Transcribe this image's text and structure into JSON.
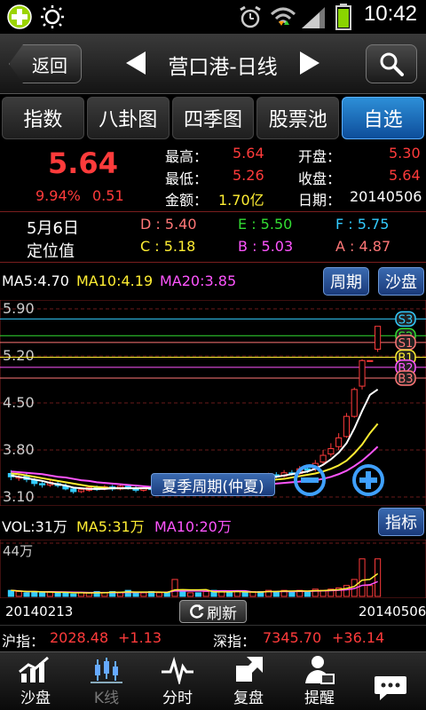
{
  "status": {
    "time": "10:42"
  },
  "header": {
    "back_label": "返回",
    "title": "营口港-日线"
  },
  "tabs": [
    {
      "label": "指数",
      "active": false
    },
    {
      "label": "八卦图",
      "active": false
    },
    {
      "label": "四季图",
      "active": false
    },
    {
      "label": "股票池",
      "active": false
    },
    {
      "label": "自选",
      "active": true
    }
  ],
  "quote": {
    "price": "5.64",
    "change_pct": "9.94%",
    "change": "0.51",
    "high_label": "最高：",
    "high": "5.64",
    "low_label": "最低：",
    "low": "5.26",
    "amount_label": "金额：",
    "amount": "1.70亿",
    "open_label": "开盘：",
    "open": "5.30",
    "close_label": "收盘：",
    "close": "5.64",
    "date_label": "日期：",
    "date": "20140506"
  },
  "position": {
    "date": "5月6日",
    "label": "定位值",
    "D": "D : 5.40",
    "E": "E : 5.50",
    "F": "F : 5.75",
    "C": "C : 5.18",
    "B": "B : 5.03",
    "A": "A : 4.87"
  },
  "ma": {
    "ma5": "MA5:4.70",
    "ma10": "MA10:4.19",
    "ma20": "MA20:3.85",
    "period_btn": "周期",
    "sandbox_btn": "沙盘"
  },
  "kchart": {
    "y_ticks": [
      "5.90",
      "5.20",
      "4.50",
      "3.80",
      "3.10"
    ],
    "levels": [
      "S3",
      "S2",
      "S1",
      "B1",
      "B2",
      "B3"
    ],
    "season_label": "夏季周期(仲夏)"
  },
  "vol": {
    "vol": "VOL:31万",
    "ma5": "MA5:31万",
    "ma10": "MA10:20万",
    "indicator_btn": "指标",
    "ymax": "44万"
  },
  "dates": {
    "start": "20140213",
    "end": "20140506",
    "refresh": "刷新"
  },
  "index": {
    "sh_label": "沪指：",
    "sh_value": "2028.48",
    "sh_change": "+1.13",
    "sz_label": "深指：",
    "sz_value": "7345.70",
    "sz_change": "+36.14"
  },
  "nav": [
    {
      "label": "沙盘",
      "icon": "chart-up-icon",
      "enabled": true
    },
    {
      "label": "K线",
      "icon": "candlestick-icon",
      "enabled": false
    },
    {
      "label": "分时",
      "icon": "pulse-icon",
      "enabled": true
    },
    {
      "label": "复盘",
      "icon": "arrows-icon",
      "enabled": true
    },
    {
      "label": "提醒",
      "icon": "person-icon",
      "enabled": true
    },
    {
      "label": "",
      "icon": "chat-icon",
      "enabled": true
    }
  ],
  "chart_data": {
    "type": "candlestick",
    "ylim": [
      3.1,
      5.9
    ],
    "candles": [
      [
        3.45,
        3.4,
        3.5,
        3.35
      ],
      [
        3.38,
        3.4,
        3.44,
        3.34
      ],
      [
        3.42,
        3.36,
        3.45,
        3.32
      ],
      [
        3.35,
        3.3,
        3.38,
        3.26
      ],
      [
        3.3,
        3.28,
        3.34,
        3.24
      ],
      [
        3.28,
        3.32,
        3.36,
        3.25
      ],
      [
        3.3,
        3.27,
        3.33,
        3.24
      ],
      [
        3.26,
        3.22,
        3.3,
        3.2
      ],
      [
        3.22,
        3.18,
        3.25,
        3.15
      ],
      [
        3.18,
        3.21,
        3.24,
        3.16
      ],
      [
        3.2,
        3.24,
        3.27,
        3.18
      ],
      [
        3.24,
        3.21,
        3.27,
        3.19
      ],
      [
        3.22,
        3.25,
        3.28,
        3.2
      ],
      [
        3.25,
        3.22,
        3.28,
        3.19
      ],
      [
        3.22,
        3.26,
        3.29,
        3.2
      ],
      [
        3.26,
        3.23,
        3.29,
        3.21
      ],
      [
        3.23,
        3.2,
        3.26,
        3.17
      ],
      [
        3.2,
        3.23,
        3.26,
        3.18
      ],
      [
        3.23,
        3.21,
        3.25,
        3.19
      ],
      [
        3.22,
        3.26,
        3.28,
        3.2
      ],
      [
        3.26,
        3.24,
        3.29,
        3.22
      ],
      [
        3.24,
        3.28,
        3.31,
        3.22
      ],
      [
        3.28,
        3.25,
        3.31,
        3.23
      ],
      [
        3.26,
        3.3,
        3.33,
        3.24
      ],
      [
        3.3,
        3.27,
        3.33,
        3.25
      ],
      [
        3.28,
        3.32,
        3.35,
        3.26
      ],
      [
        3.32,
        3.3,
        3.36,
        3.28
      ],
      [
        3.3,
        3.34,
        3.37,
        3.28
      ],
      [
        3.34,
        3.32,
        3.38,
        3.3
      ],
      [
        3.33,
        3.36,
        3.4,
        3.31
      ],
      [
        3.36,
        3.34,
        3.4,
        3.32
      ],
      [
        3.35,
        3.4,
        3.43,
        3.33
      ],
      [
        3.4,
        3.38,
        3.44,
        3.36
      ],
      [
        3.38,
        3.43,
        3.46,
        3.36
      ],
      [
        3.43,
        3.4,
        3.47,
        3.38
      ],
      [
        3.41,
        3.46,
        3.5,
        3.39
      ],
      [
        3.46,
        3.44,
        3.5,
        3.42
      ],
      [
        3.45,
        3.52,
        3.56,
        3.43
      ],
      [
        3.52,
        3.5,
        3.58,
        3.46
      ],
      [
        3.51,
        3.6,
        3.65,
        3.48
      ],
      [
        3.62,
        3.72,
        3.8,
        3.58
      ],
      [
        3.74,
        3.82,
        3.9,
        3.7
      ],
      [
        3.85,
        3.98,
        4.05,
        3.8
      ],
      [
        4.0,
        4.3,
        4.35,
        3.98
      ],
      [
        4.3,
        4.7,
        4.73,
        4.28
      ],
      [
        4.75,
        5.13,
        5.15,
        4.7
      ],
      [
        5.13,
        5.13,
        5.13,
        5.13
      ],
      [
        5.3,
        5.64,
        5.64,
        5.26
      ]
    ],
    "ma5": [
      3.42,
      3.4,
      3.38,
      3.36,
      3.34,
      3.31,
      3.29,
      3.27,
      3.24,
      3.23,
      3.22,
      3.22,
      3.22,
      3.23,
      3.23,
      3.23,
      3.23,
      3.23,
      3.23,
      3.23,
      3.23,
      3.24,
      3.25,
      3.26,
      3.27,
      3.28,
      3.29,
      3.3,
      3.31,
      3.33,
      3.34,
      3.35,
      3.36,
      3.38,
      3.4,
      3.42,
      3.44,
      3.46,
      3.48,
      3.52,
      3.58,
      3.66,
      3.76,
      3.9,
      4.12,
      4.38,
      4.62,
      4.7
    ],
    "ma10": [
      3.45,
      3.44,
      3.42,
      3.4,
      3.38,
      3.36,
      3.34,
      3.32,
      3.3,
      3.28,
      3.26,
      3.25,
      3.24,
      3.23,
      3.23,
      3.23,
      3.23,
      3.23,
      3.23,
      3.23,
      3.23,
      3.23,
      3.24,
      3.24,
      3.25,
      3.25,
      3.26,
      3.27,
      3.28,
      3.29,
      3.3,
      3.31,
      3.33,
      3.34,
      3.36,
      3.37,
      3.39,
      3.41,
      3.43,
      3.45,
      3.48,
      3.52,
      3.57,
      3.64,
      3.75,
      3.88,
      4.05,
      4.19
    ],
    "ma20": [
      3.48,
      3.47,
      3.46,
      3.45,
      3.44,
      3.42,
      3.4,
      3.39,
      3.37,
      3.35,
      3.34,
      3.32,
      3.31,
      3.3,
      3.29,
      3.28,
      3.27,
      3.26,
      3.25,
      3.25,
      3.25,
      3.25,
      3.25,
      3.25,
      3.25,
      3.25,
      3.25,
      3.25,
      3.26,
      3.26,
      3.27,
      3.27,
      3.28,
      3.29,
      3.3,
      3.31,
      3.32,
      3.33,
      3.34,
      3.35,
      3.37,
      3.4,
      3.44,
      3.49,
      3.56,
      3.64,
      3.74,
      3.85
    ],
    "level_values": [
      5.75,
      5.5,
      5.4,
      5.18,
      5.03,
      4.87
    ],
    "volume": {
      "ylim_max": 44,
      "values": [
        5,
        4,
        3,
        4,
        3,
        4,
        3,
        3,
        2,
        3,
        3,
        4,
        3,
        4,
        3,
        5,
        3,
        3,
        4,
        3,
        3,
        14,
        4,
        3,
        3,
        4,
        5,
        4,
        3,
        4,
        3,
        4,
        4,
        5,
        4,
        5,
        4,
        5,
        4,
        6,
        5,
        6,
        7,
        9,
        14,
        31,
        9,
        31
      ]
    }
  }
}
